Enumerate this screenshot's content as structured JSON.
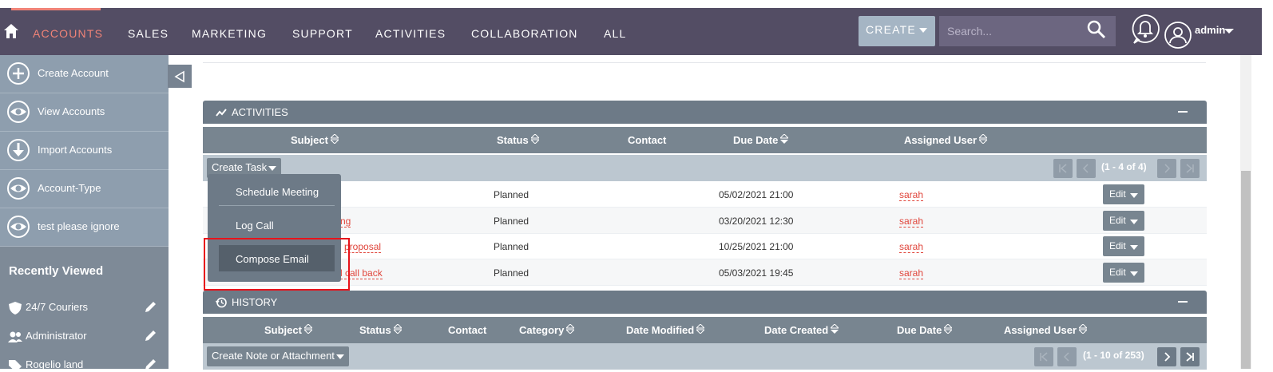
{
  "topnav": {
    "items": [
      "ACCOUNTS",
      "SALES",
      "MARKETING",
      "SUPPORT",
      "ACTIVITIES",
      "COLLABORATION",
      "ALL"
    ],
    "active": "ACCOUNTS",
    "create_label": "CREATE",
    "search_placeholder": "Search...",
    "user_label": "admin"
  },
  "sidebar": {
    "actions": [
      {
        "label": "Create Account",
        "icon": "plus-circle-icon"
      },
      {
        "label": "View Accounts",
        "icon": "eye-icon"
      },
      {
        "label": "Import Accounts",
        "icon": "download-arrow-icon"
      },
      {
        "label": "Account-Type",
        "icon": "eye-icon"
      },
      {
        "label": "test please ignore",
        "icon": "eye-icon"
      }
    ],
    "recent_title": "Recently Viewed",
    "recent": [
      {
        "label": "24/7 Couriers",
        "icon": "shield-icon"
      },
      {
        "label": "Administrator",
        "icon": "users-icon"
      },
      {
        "label": "Rogelio land",
        "icon": "tag-icon"
      }
    ]
  },
  "activities": {
    "title": "ACTIVITIES",
    "columns": [
      "Subject",
      "Status",
      "Contact",
      "Due Date",
      "Assigned User"
    ],
    "create_button": "Create Task",
    "pagination": "(1 - 4 of 4)",
    "rows": [
      {
        "subject": "",
        "status": "Planned",
        "contact": "",
        "due": "05/02/2021 21:00",
        "user": "sarah",
        "edit": "Edit"
      },
      {
        "subject": "ng",
        "status": "Planned",
        "contact": "",
        "due": "03/20/2021 12:30",
        "user": "sarah",
        "edit": "Edit"
      },
      {
        "subject": "proposal",
        "status": "Planned",
        "contact": "",
        "due": "10/25/2021 21:00",
        "user": "sarah",
        "edit": "Edit"
      },
      {
        "subject": "l call back",
        "status": "Planned",
        "contact": "",
        "due": "05/03/2021 19:45",
        "user": "sarah",
        "edit": "Edit"
      }
    ],
    "dropdown": [
      "Schedule Meeting",
      "Log Call",
      "Compose Email"
    ]
  },
  "history": {
    "title": "HISTORY",
    "columns": [
      "Subject",
      "Status",
      "Contact",
      "Category",
      "Date Modified",
      "Date Created",
      "Due Date",
      "Assigned User"
    ],
    "create_button": "Create Note or Attachment",
    "pagination": "(1 - 10 of 253)"
  },
  "colors": {
    "topbar": "#534d64",
    "accent": "#f08377",
    "link_red": "#e0453b",
    "panel": "#6d7a87",
    "highlight_box": "#e8131b"
  }
}
